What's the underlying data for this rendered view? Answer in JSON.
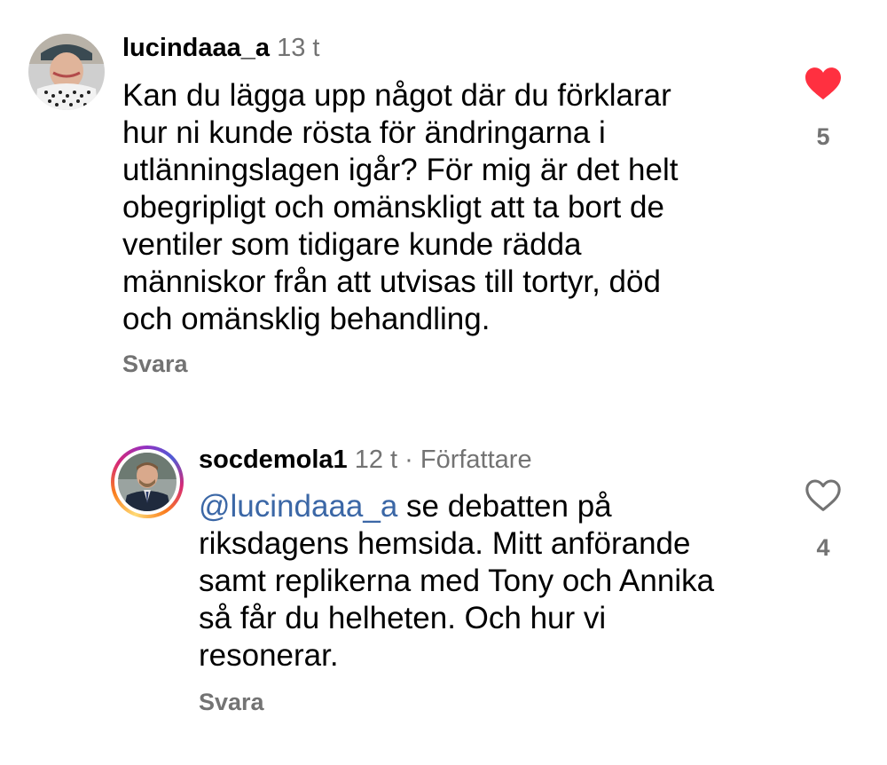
{
  "comments": [
    {
      "username": "lucindaaa_a",
      "time": "13 t",
      "lines": [
        "Kan du lägga upp något där du förklarar",
        "hur ni kunde rösta för ändringarna i",
        "utlänningslagen igår? För mig är det helt",
        "obegripligt och omänskligt att ta bort de",
        "ventiler som tidigare kunde rädda",
        "människor från att utvisas till tortyr, död",
        "och omänsklig behandling."
      ],
      "reply_label": "Svara",
      "likes": "5",
      "liked": true,
      "like_color": "#ff3040"
    },
    {
      "username": "socdemola1",
      "time": "12 t",
      "separator": "·",
      "role": "Författare",
      "mention": "@lucindaaa_a",
      "lines": [
        " se debatten på",
        "riksdagens hemsida. Mitt anförande",
        "samt replikerna med Tony och Annika",
        "så får du helheten. Och hur vi",
        "resonerar."
      ],
      "reply_label": "Svara",
      "likes": "4",
      "liked": false
    }
  ],
  "colors": {
    "secondary_text": "#737373",
    "mention": "#3b67a6",
    "story_ring": [
      "#feda75",
      "#fa7e1e",
      "#d62976",
      "#962fbf",
      "#4f5bd5"
    ]
  }
}
